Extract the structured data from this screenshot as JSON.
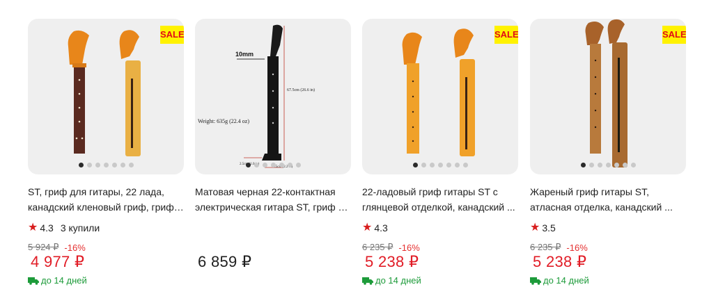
{
  "products": [
    {
      "title_line1": "ST, гриф для гитары, 22 лада,",
      "title_line2": "канадский кленовый гриф, гриф ...",
      "sale_badge": "SALE",
      "rating": "4.3",
      "buyers": "3 купили",
      "old_price": "5 924 ₽",
      "discount": "-16%",
      "price": "4 977 ₽",
      "delivery": "до 14 дней"
    },
    {
      "title_line1": "Матовая черная 22-контактная",
      "title_line2": "электрическая гитара ST, гриф и...",
      "image_labels": {
        "width_top": "10mm",
        "length": "67.5cm (26.6 in)",
        "weight": "Weight: 635g (22.4 oz)",
        "width_a": "2.5cm (1.0 in)",
        "width_b": "5.5cm (2.2 in)"
      },
      "price": "6 859 ₽"
    },
    {
      "title_line1": "22-ладовый гриф гитары ST с",
      "title_line2": "глянцевой отделкой, канадский ...",
      "sale_badge": "SALE",
      "rating": "4.3",
      "old_price": "6 235 ₽",
      "discount": "-16%",
      "price": "5 238 ₽",
      "delivery": "до 14 дней"
    },
    {
      "title_line1": "Жареный гриф гитары ST,",
      "title_line2": "атласная отделка, канадский ...",
      "sale_badge": "SALE",
      "rating": "3.5",
      "old_price": "6 235 ₽",
      "discount": "-16%",
      "price": "5 238 ₽",
      "delivery": "до 14 дней"
    }
  ],
  "colors": {
    "price_red": "#e11c26",
    "delivery_green": "#1d9b3a",
    "sale_yellow": "#fff200",
    "star_red": "#d81e1e"
  },
  "icons": {
    "star": "star-icon",
    "truck": "truck-icon"
  }
}
